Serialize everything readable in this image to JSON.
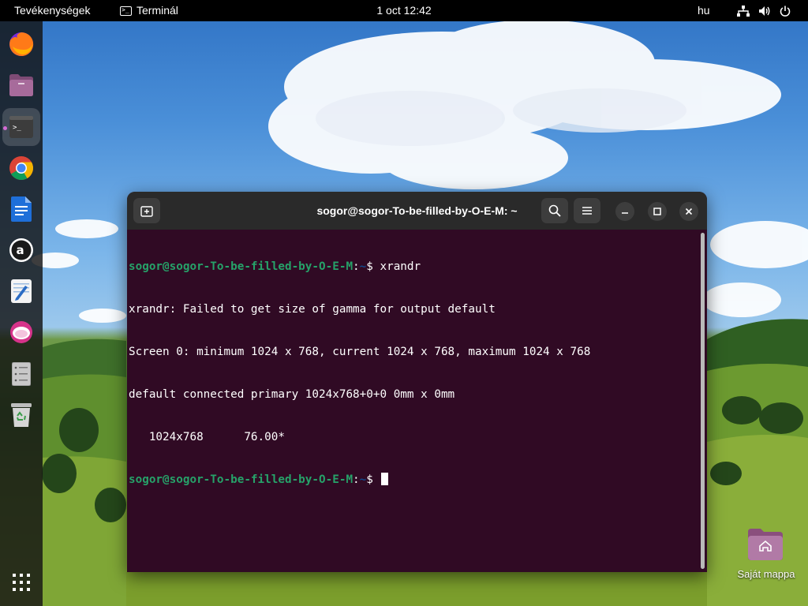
{
  "topbar": {
    "activities": "Tevékenységek",
    "app_name": "Terminál",
    "clock": "1 oct  12:42",
    "language": "hu",
    "icons": [
      "network-icon",
      "volume-icon",
      "power-icon"
    ]
  },
  "dock": {
    "items": [
      {
        "name": "Firefox",
        "icon": "firefox-icon"
      },
      {
        "name": "Files",
        "icon": "files-icon"
      },
      {
        "name": "Terminal",
        "icon": "terminal-icon",
        "active": true
      },
      {
        "name": "Chrome",
        "icon": "chrome-icon"
      },
      {
        "name": "Writer",
        "icon": "writer-icon"
      },
      {
        "name": "Amazon",
        "icon": "amazon-icon"
      },
      {
        "name": "Text Editor",
        "icon": "text-editor-icon"
      },
      {
        "name": "App",
        "icon": "pink-app-icon"
      },
      {
        "name": "Storage",
        "icon": "storage-icon"
      },
      {
        "name": "Trash",
        "icon": "trash-icon"
      }
    ],
    "show_apps_icon": "grid-icon"
  },
  "terminal": {
    "title": "sogor@sogor-To-be-filled-by-O-E-M: ~",
    "prompt_user": "sogor@sogor-To-be-filled-by-O-E-M",
    "prompt_sep": ":",
    "prompt_path": "~",
    "prompt_symbol": "$ ",
    "command": "xrandr",
    "output": [
      "xrandr: Failed to get size of gamma for output default",
      "Screen 0: minimum 1024 x 768, current 1024 x 768, maximum 1024 x 768",
      "default connected primary 1024x768+0+0 0mm x 0mm",
      "   1024x768      76.00*"
    ]
  },
  "desktop": {
    "home_folder_label": "Saját mappa"
  },
  "colors": {
    "terminal_bg": "#300a24",
    "prompt_user": "#26a269",
    "prompt_path": "#12488b",
    "titlebar": "#2a2a2a"
  }
}
